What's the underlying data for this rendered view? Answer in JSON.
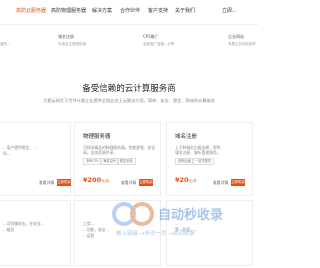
{
  "nav": {
    "items": [
      "高防云服务器",
      "高防物理服务器",
      "解决方案",
      "合作伙伴",
      "客户支持",
      "关于我们"
    ],
    "button": "立即..."
  },
  "top_cards": [
    {
      "title": "",
      "desc": "高防..."
    },
    {
      "title": "域名注册",
      "desc": "优选名注册超优惠"
    },
    {
      "title": "CPS推广",
      "desc": "全新推广返佣...分享"
    },
    {
      "title": "企业网站",
      "desc": "专属企业网站制作"
    }
  ],
  "section": {
    "title": "备受信赖的云计算服务商",
    "subtitle": "主题云网大于为并计量企业提供全链业务上云解决方案，简单、安全、稳定、高效的计算服务"
  },
  "products": [
    {
      "title": "",
      "desc": [
        "...用户提供稳定、...",
        "所..."
      ],
      "tags": [
        "..."
      ],
      "more": "查看详情",
      "buy": "立即购买",
      "price": ""
    },
    {
      "title": "物理服务器",
      "desc": [
        "可独享精选的物理服务器。性能更强、安全",
        "高，告别资源共享。"
      ],
      "tags": [
        "多种CPU",
        "海量空间",
        "稳定系统"
      ],
      "more": "查看详情",
      "buy": "立即购买",
      "price": "200",
      "unit": "元/月"
    },
    {
      "title": "域名注册",
      "desc": [
        "上万种域名后缀选择，提供",
        "域名注册、解析管理服务。"
      ],
      "tags": [
        "多种后缀",
        "一站式服务"
      ],
      "more": "查看详情",
      "buy": "立即购买",
      "price": "20",
      "unit": "元/年"
    },
    {
      "title": "",
      "desc": [
        "...可防御攻击，在安全...",
        "...服务"
      ],
      "tags": [],
      "more": "",
      "buy": "",
      "price": ""
    },
    {
      "title": "",
      "desc": [
        "工商...",
        "...功能，安全...",
        "...运营"
      ],
      "tags": [],
      "more": "",
      "buy": "",
      "price": ""
    },
    {
      "title": "",
      "desc": [
        "...",
        "等...并发，..."
      ],
      "tags": [],
      "more": "",
      "buy": "",
      "price": ""
    }
  ],
  "watermark": {
    "text1": "自动秒收录",
    "text2": "做上链接 →来访一次 →自动收录"
  }
}
